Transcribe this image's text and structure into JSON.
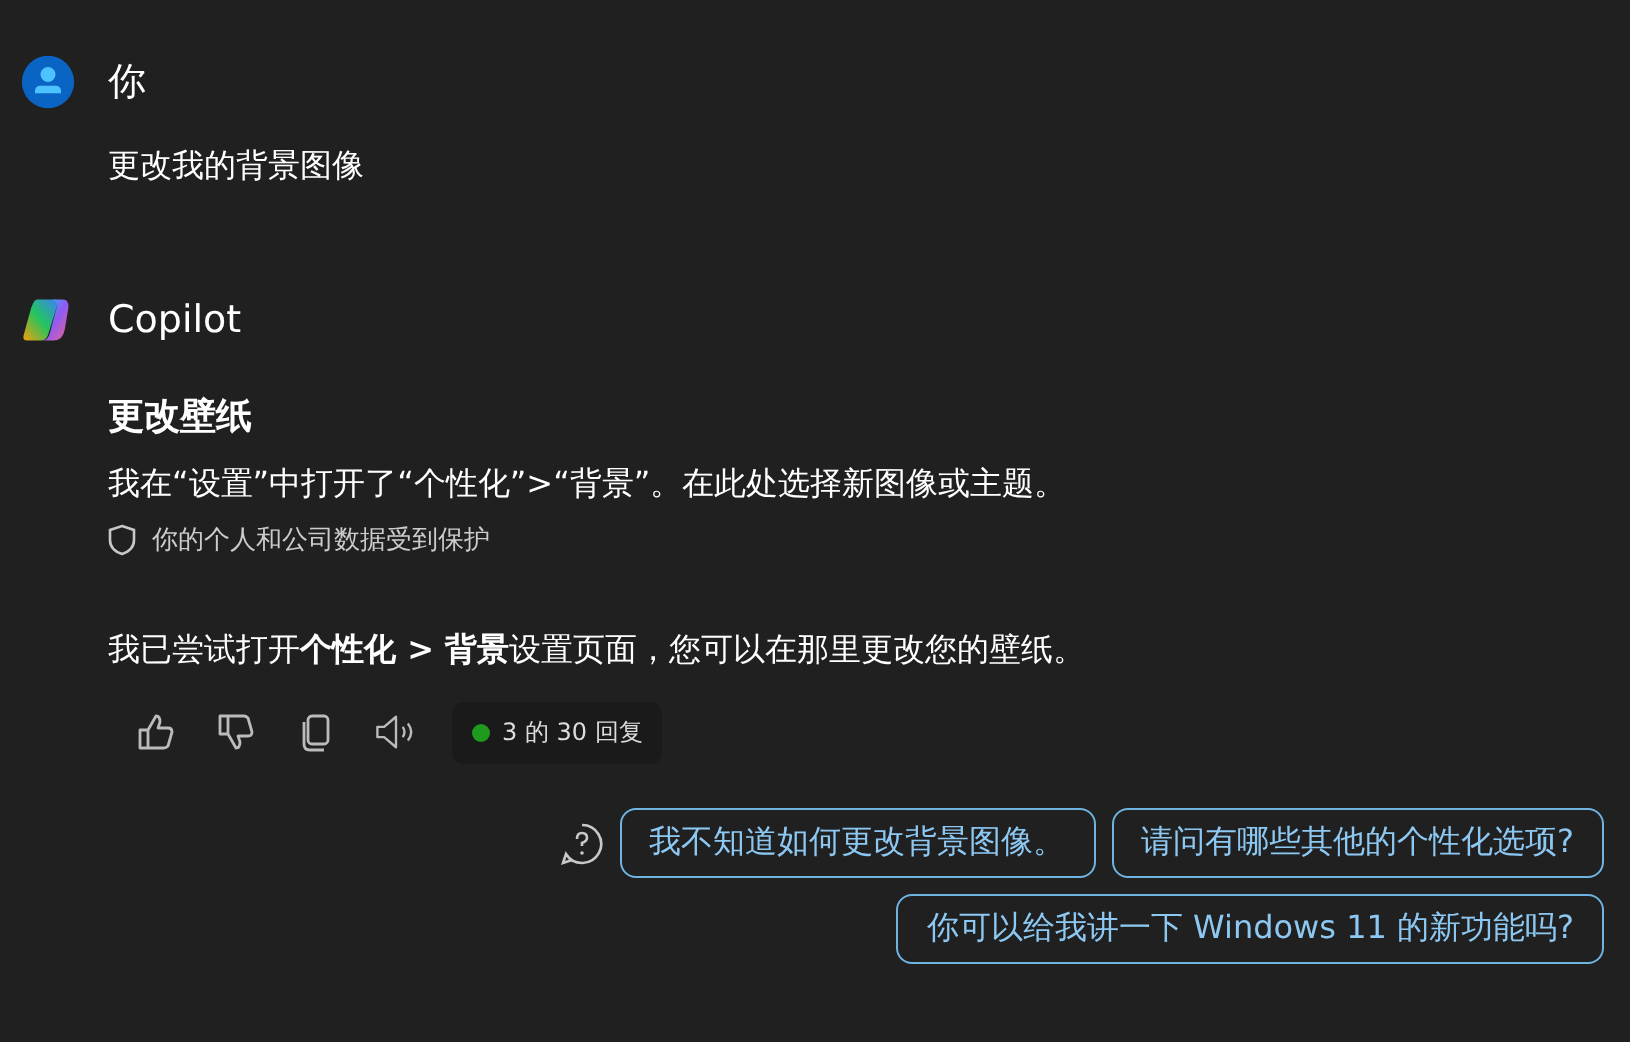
{
  "user_message": {
    "author": "你",
    "text": "更改我的背景图像"
  },
  "assistant_message": {
    "author": "Copilot",
    "title": "更改壁纸",
    "body": "我在“设置”中打开了“个性化”>“背景”。在此处选择新图像或主题。",
    "privacy_note": "你的个人和公司数据受到保护",
    "answer": "我已尝试打开**个性化 > 背景**设置页面，您可以在那里更改您的壁纸。",
    "response_counter": "3 的 30 回复"
  },
  "suggestions": [
    "我不知道如何更改背景图像。",
    "请问有哪些其他的个性化选项?",
    "你可以给我讲一下 Windows 11 的新功能吗?"
  ]
}
